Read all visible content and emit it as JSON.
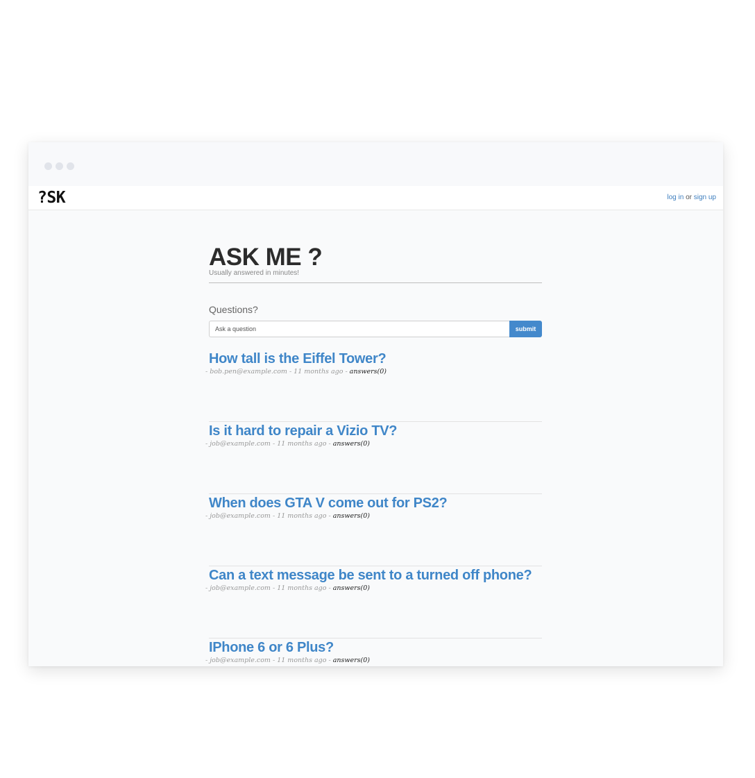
{
  "navbar": {
    "logo": "?SK",
    "login_label": "log in",
    "separator": "or",
    "signup_label": "sign up"
  },
  "hero": {
    "title": "ASK ME ?",
    "subtitle": "Usually answered in minutes!"
  },
  "ask": {
    "label": "Questions?",
    "placeholder": "Ask a question",
    "submit_label": "submit"
  },
  "questions": [
    {
      "title": "How tall is the Eiffel Tower?",
      "prefix": "- ",
      "author": "bob.pen@example.com",
      "sep1": " - ",
      "time": "11 months ago",
      "sep2": " - ",
      "answers": "answers(0)"
    },
    {
      "title": "Is it hard to repair a Vizio TV?",
      "prefix": "- ",
      "author": "job@example.com",
      "sep1": " - ",
      "time": "11 months ago",
      "sep2": " - ",
      "answers": "answers(0)"
    },
    {
      "title": "When does GTA V come out for PS2?",
      "prefix": "- ",
      "author": "job@example.com",
      "sep1": " - ",
      "time": "11 months ago",
      "sep2": " - ",
      "answers": "answers(0)"
    },
    {
      "title": "Can a text message be sent to a turned off phone?",
      "prefix": "- ",
      "author": "job@example.com",
      "sep1": " - ",
      "time": "11 months ago",
      "sep2": " - ",
      "answers": "answers(0)"
    },
    {
      "title": "IPhone 6 or 6 Plus?",
      "prefix": "- ",
      "author": "job@example.com",
      "sep1": " - ",
      "time": "11 months ago",
      "sep2": " - ",
      "answers": "answers(0)"
    }
  ],
  "colors": {
    "link_blue": "#3f86c8",
    "submit_blue": "#4489cc",
    "background": "#f9fafb"
  }
}
